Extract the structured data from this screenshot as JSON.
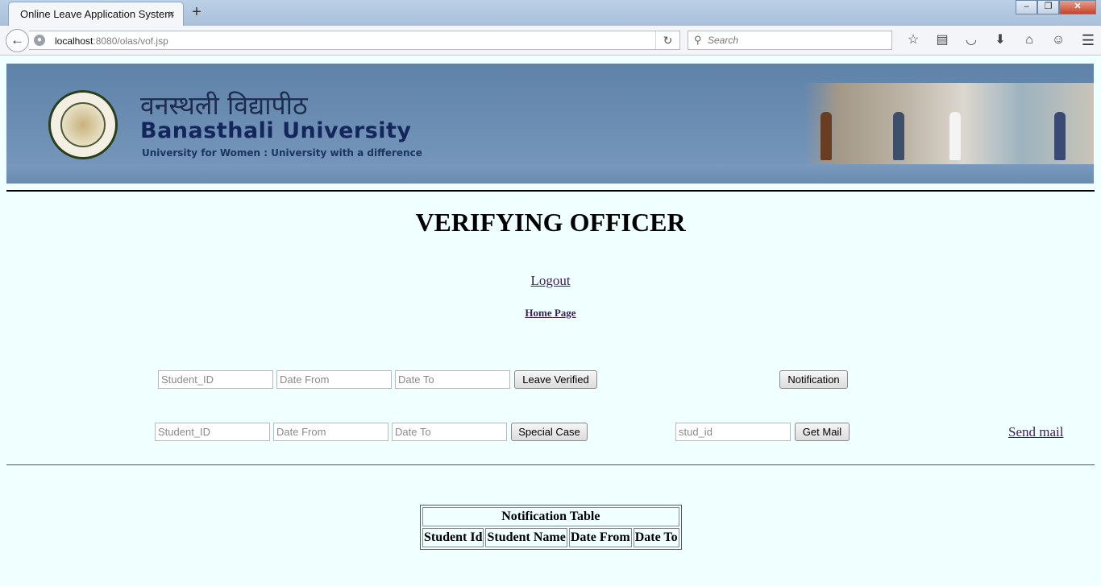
{
  "browser": {
    "tab_title": "Online Leave Application System",
    "tab_close": "×",
    "new_tab": "+",
    "url_host": "localhost",
    "url_rest": ":8080/olas/vof.jsp",
    "search_placeholder": "Search",
    "window_buttons": [
      "–",
      "❐",
      "✕"
    ],
    "toolbar_icons": [
      "bookmark-star-icon",
      "reading-list-icon",
      "pocket-icon",
      "download-icon",
      "home-icon",
      "chat-icon"
    ],
    "toolbar_glyphs": [
      "☆",
      "▤",
      "◡",
      "⬇",
      "⌂",
      "☺"
    ]
  },
  "banner": {
    "hindi_name": "वनस्थली विद्यापीठ",
    "university_name": "Banasthali University",
    "tagline": "University for Women : University with a difference"
  },
  "page": {
    "heading": "VERIFYING OFFICER",
    "logout_link": "Logout",
    "home_link": "Home Page",
    "send_mail_link": "Send mail"
  },
  "leave_form": {
    "student_id_placeholder": "Student_ID",
    "date_from_placeholder": "Date From",
    "date_to_placeholder": "Date To",
    "submit_label": "Leave Verified",
    "notification_label": "Notification"
  },
  "special_form": {
    "student_id_placeholder": "Student_ID",
    "date_from_placeholder": "Date From",
    "date_to_placeholder": "Date To",
    "submit_label": "Special Case"
  },
  "mail_form": {
    "stud_id_placeholder": "stud_id",
    "submit_label": "Get Mail"
  },
  "notification_table": {
    "caption": "Notification Table",
    "columns": [
      "Student Id",
      "Student Name",
      "Date From",
      "Date To"
    ]
  }
}
